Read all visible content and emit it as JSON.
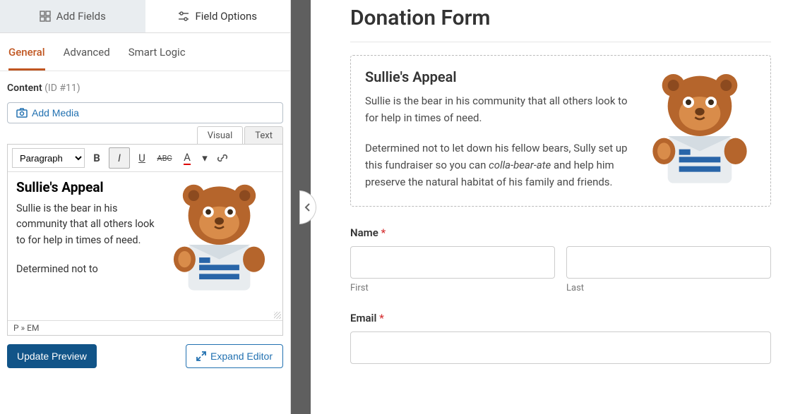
{
  "top_tabs": {
    "add_fields": "Add Fields",
    "field_options": "Field Options"
  },
  "sub_tabs": {
    "general": "General",
    "advanced": "Advanced",
    "smart_logic": "Smart Logic"
  },
  "content": {
    "label": "Content",
    "id": "(ID #11)"
  },
  "add_media": "Add Media",
  "editor_tabs": {
    "visual": "Visual",
    "text": "Text"
  },
  "toolbar": {
    "paragraph": "Paragraph"
  },
  "editor": {
    "heading": "Sullie's Appeal",
    "p1": "Sullie is the bear in his community that all others look to for help in times of need.",
    "p2": "Determined not to"
  },
  "status_path": "P » EM",
  "buttons": {
    "update": "Update Preview",
    "expand": "Expand Editor"
  },
  "form": {
    "title": "Donation Form",
    "appeal_title": "Sullie's Appeal",
    "appeal_p1": "Sullie is the bear in his community that all others look to for help in times of need.",
    "appeal_p2a": "Determined not to let down his fellow bears, Sully set up this fundraiser so you can ",
    "appeal_p2_em": "colla-bear-ate",
    "appeal_p2b": " and help him preserve the natural habitat of his family and friends.",
    "name_label": "Name",
    "first_label": "First",
    "last_label": "Last",
    "email_label": "Email"
  }
}
